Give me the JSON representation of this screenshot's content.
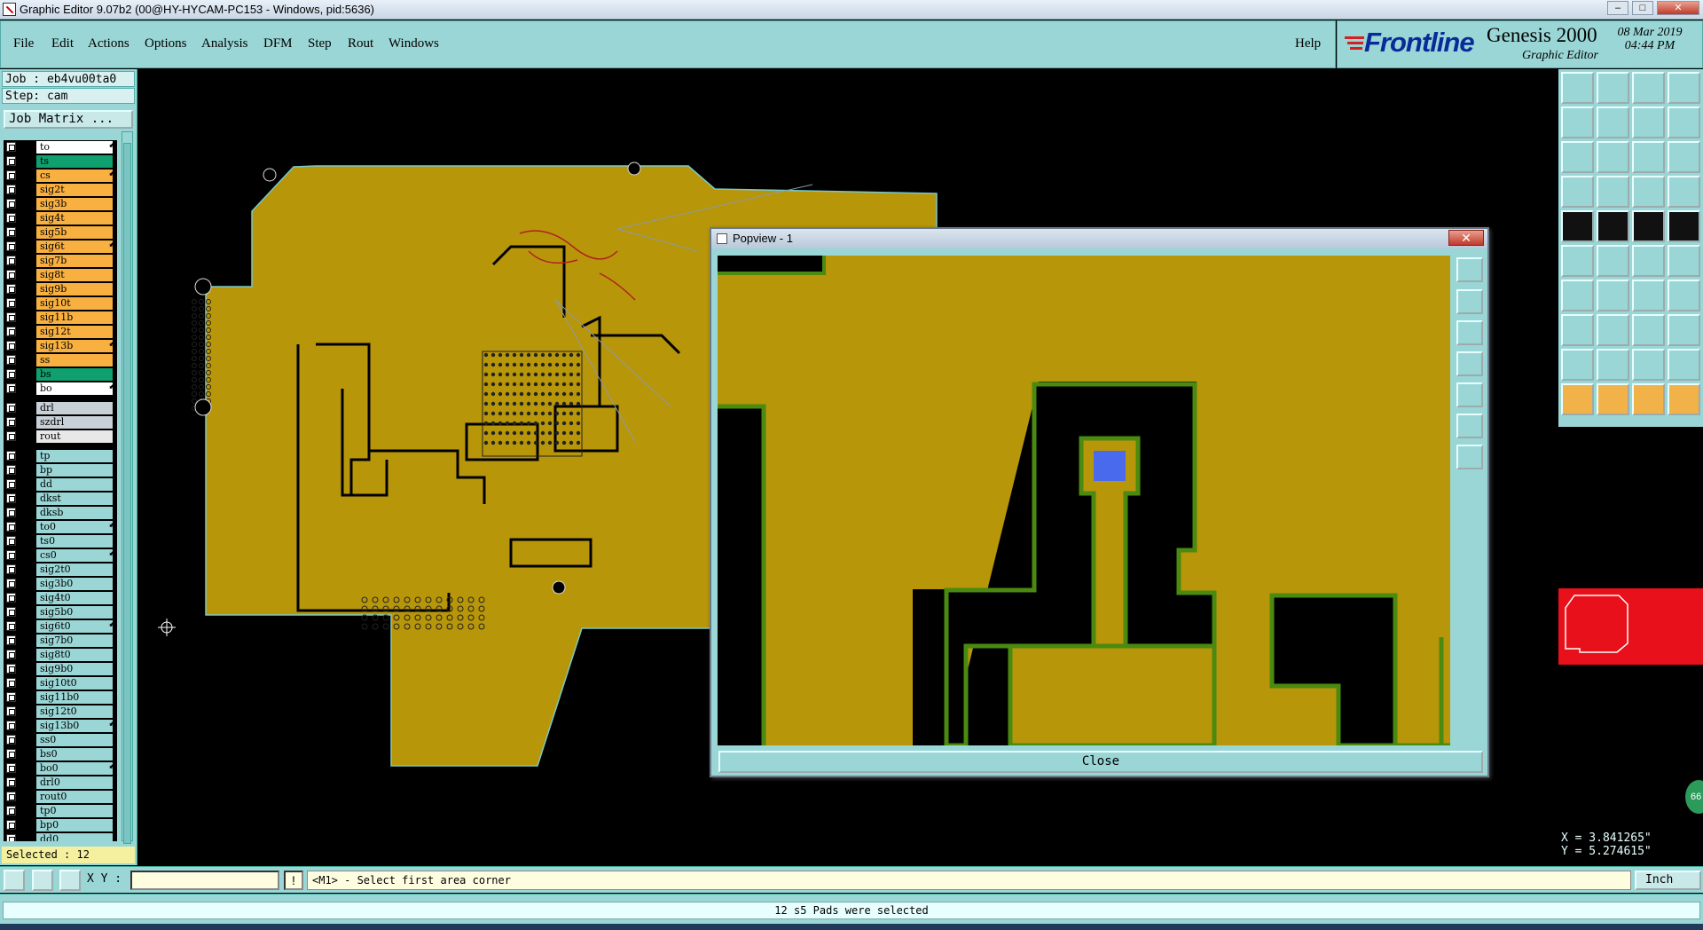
{
  "window": {
    "title": "Graphic Editor 9.07b2 (00@HY-HYCAM-PC153 - Windows, pid:5636)"
  },
  "menu": {
    "items": [
      {
        "label": "File"
      },
      {
        "label": "Edit"
      },
      {
        "label": "Actions"
      },
      {
        "label": "Options"
      },
      {
        "label": "Analysis"
      },
      {
        "label": "DFM"
      },
      {
        "label": "Step"
      },
      {
        "label": "Rout"
      },
      {
        "label": "Windows"
      }
    ],
    "help": "Help"
  },
  "brand": {
    "logo": "Frontline",
    "product": "Genesis 2000",
    "subtitle": "Graphic Editor",
    "date": "08 Mar 2019",
    "time": "04:44 PM"
  },
  "job": {
    "job_line": "Job : eb4vu00ta0",
    "step_line": "Step: cam",
    "matrix_button": "Job Matrix ..."
  },
  "layers": [
    {
      "name": "to",
      "color": "#ffffff",
      "mark": "⬋"
    },
    {
      "name": "ts",
      "color": "#10a070",
      "mark": ""
    },
    {
      "name": "cs",
      "color": "#f8b040",
      "mark": "⬋"
    },
    {
      "name": "sig2t",
      "color": "#f8b040",
      "mark": ""
    },
    {
      "name": "sig3b",
      "color": "#f8b040",
      "mark": ""
    },
    {
      "name": "sig4t",
      "color": "#f8b040",
      "mark": ""
    },
    {
      "name": "sig5b",
      "color": "#f8b040",
      "mark": ""
    },
    {
      "name": "sig6t",
      "color": "#f8b040",
      "mark": "⬋"
    },
    {
      "name": "sig7b",
      "color": "#f8b040",
      "mark": ""
    },
    {
      "name": "sig8t",
      "color": "#f8b040",
      "mark": ""
    },
    {
      "name": "sig9b",
      "color": "#f8b040",
      "mark": ""
    },
    {
      "name": "sig10t",
      "color": "#f8b040",
      "mark": ""
    },
    {
      "name": "sig11b",
      "color": "#f8b040",
      "mark": ""
    },
    {
      "name": "sig12t",
      "color": "#f8b040",
      "mark": ""
    },
    {
      "name": "sig13b",
      "color": "#f8b040",
      "mark": "⬋"
    },
    {
      "name": "ss",
      "color": "#f8b040",
      "mark": ""
    },
    {
      "name": "bs",
      "color": "#10a070",
      "mark": ""
    },
    {
      "name": "bo",
      "color": "#ffffff",
      "mark": "⬋"
    },
    {
      "name": "drl",
      "color": "#c8d0d8",
      "mark": ""
    },
    {
      "name": "szdrl",
      "color": "#c8d0d8",
      "mark": ""
    },
    {
      "name": "rout",
      "color": "#e8e8e8",
      "mark": ""
    },
    {
      "name": "tp",
      "color": "#9ad6d6",
      "mark": ""
    },
    {
      "name": "bp",
      "color": "#9ad6d6",
      "mark": ""
    },
    {
      "name": "dd",
      "color": "#9ad6d6",
      "mark": ""
    },
    {
      "name": "dkst",
      "color": "#9ad6d6",
      "mark": ""
    },
    {
      "name": "dksb",
      "color": "#9ad6d6",
      "mark": ""
    },
    {
      "name": "to0",
      "color": "#9ad6d6",
      "mark": "⬋"
    },
    {
      "name": "ts0",
      "color": "#9ad6d6",
      "mark": ""
    },
    {
      "name": "cs0",
      "color": "#9ad6d6",
      "mark": "⬋"
    },
    {
      "name": "sig2t0",
      "color": "#9ad6d6",
      "mark": ""
    },
    {
      "name": "sig3b0",
      "color": "#9ad6d6",
      "mark": ""
    },
    {
      "name": "sig4t0",
      "color": "#9ad6d6",
      "mark": ""
    },
    {
      "name": "sig5b0",
      "color": "#9ad6d6",
      "mark": ""
    },
    {
      "name": "sig6t0",
      "color": "#9ad6d6",
      "mark": "⬋"
    },
    {
      "name": "sig7b0",
      "color": "#9ad6d6",
      "mark": ""
    },
    {
      "name": "sig8t0",
      "color": "#9ad6d6",
      "mark": ""
    },
    {
      "name": "sig9b0",
      "color": "#9ad6d6",
      "mark": ""
    },
    {
      "name": "sig10t0",
      "color": "#9ad6d6",
      "mark": ""
    },
    {
      "name": "sig11b0",
      "color": "#9ad6d6",
      "mark": ""
    },
    {
      "name": "sig12t0",
      "color": "#9ad6d6",
      "mark": ""
    },
    {
      "name": "sig13b0",
      "color": "#9ad6d6",
      "mark": "⬋"
    },
    {
      "name": "ss0",
      "color": "#9ad6d6",
      "mark": ""
    },
    {
      "name": "bs0",
      "color": "#9ad6d6",
      "mark": ""
    },
    {
      "name": "bo0",
      "color": "#9ad6d6",
      "mark": "⬋"
    },
    {
      "name": "drl0",
      "color": "#9ad6d6",
      "mark": ""
    },
    {
      "name": "rout0",
      "color": "#9ad6d6",
      "mark": ""
    },
    {
      "name": "tp0",
      "color": "#9ad6d6",
      "mark": ""
    },
    {
      "name": "bp0",
      "color": "#9ad6d6",
      "mark": ""
    },
    {
      "name": "dd0",
      "color": "#9ad6d6",
      "mark": ""
    }
  ],
  "selected": "Selected : 12",
  "popview": {
    "title": "Popview - 1",
    "close_label": "Close",
    "close_x": "✕"
  },
  "coords": {
    "x": "X = 3.841265\"",
    "y": "Y = 5.274615\""
  },
  "cmd": {
    "xy_label": "X Y :",
    "xy_value": "",
    "separator": "!",
    "prompt": "<M1> - Select first area corner",
    "units": "Inch"
  },
  "status": "12 s5 Pads were selected",
  "badge": "66",
  "colors": {
    "copper": "#b8960a",
    "panel": "#9ad6d6",
    "selection_green": "#4a8a10",
    "pad_blue": "#4a6aee"
  }
}
